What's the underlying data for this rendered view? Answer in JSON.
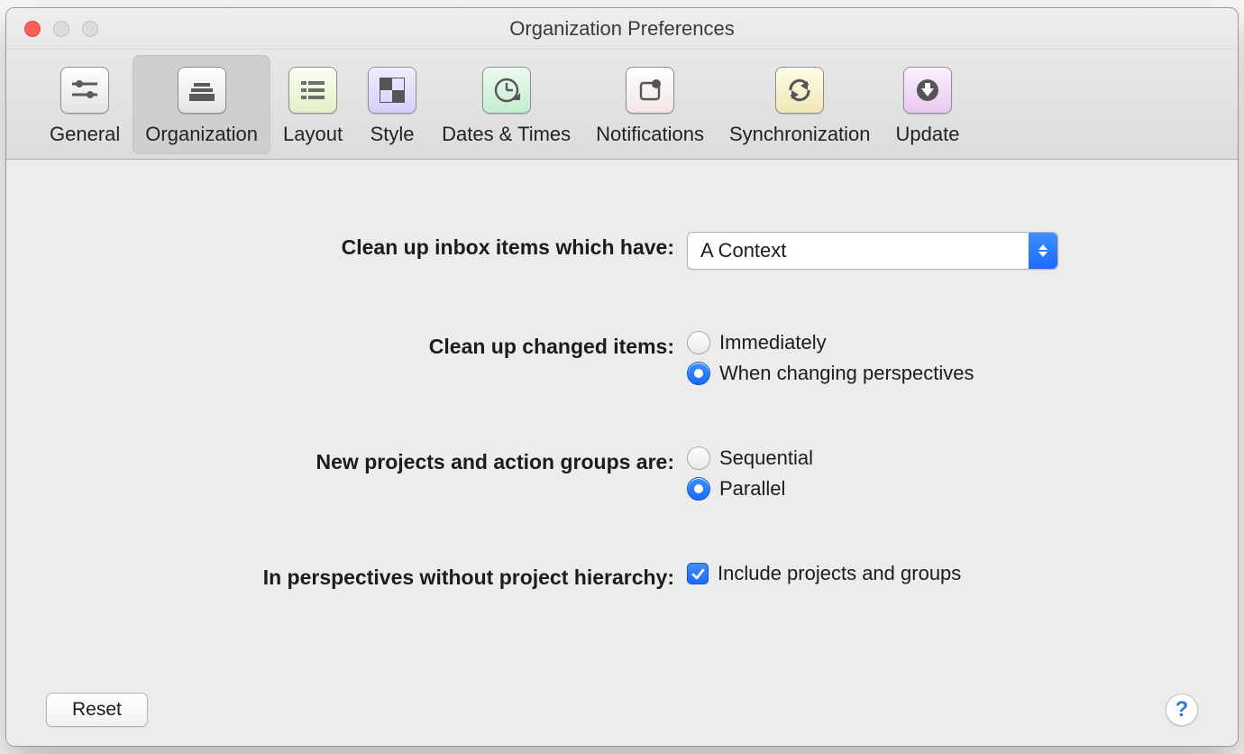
{
  "window": {
    "title": "Organization Preferences"
  },
  "toolbar": {
    "tabs": [
      {
        "label": "General"
      },
      {
        "label": "Organization"
      },
      {
        "label": "Layout"
      },
      {
        "label": "Style"
      },
      {
        "label": "Dates & Times"
      },
      {
        "label": "Notifications"
      },
      {
        "label": "Synchronization"
      },
      {
        "label": "Update"
      }
    ],
    "selected_index": 1
  },
  "form": {
    "cleanup_inbox": {
      "label": "Clean up inbox items which have:",
      "value": "A Context"
    },
    "cleanup_changed": {
      "label": "Clean up changed items:",
      "options": [
        "Immediately",
        "When changing perspectives"
      ],
      "selected_index": 1
    },
    "new_projects": {
      "label": "New projects and action groups are:",
      "options": [
        "Sequential",
        "Parallel"
      ],
      "selected_index": 1
    },
    "perspectives": {
      "label": "In perspectives without project hierarchy:",
      "checkbox_label": "Include projects and groups",
      "checked": true
    }
  },
  "footer": {
    "reset": "Reset",
    "help": "?"
  }
}
